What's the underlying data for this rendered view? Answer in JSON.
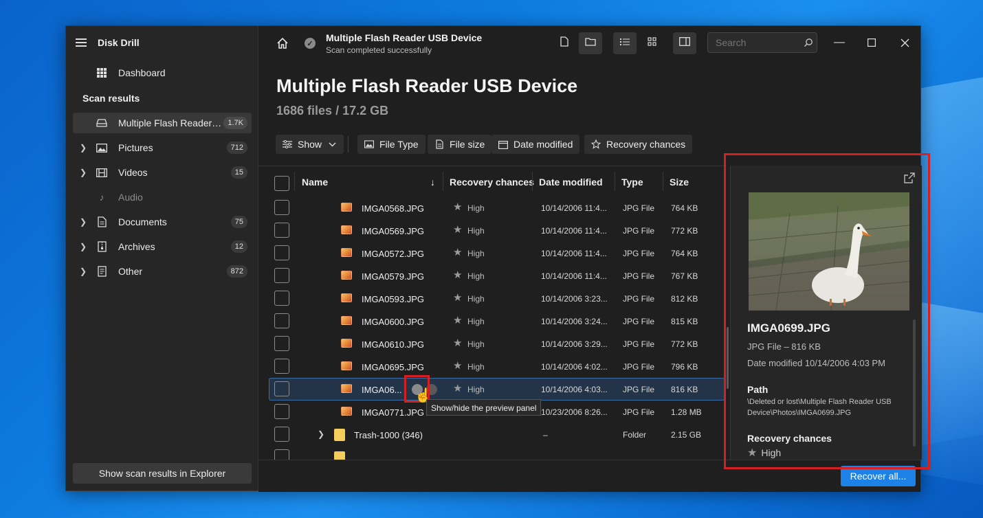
{
  "colors": {
    "accent": "#1d82e8",
    "highlight_box": "#d42020"
  },
  "app": {
    "title": "Disk Drill"
  },
  "sidebar": {
    "dashboard": "Dashboard",
    "section": "Scan results",
    "device": {
      "label": "Multiple Flash Reader U...",
      "count": "1.7K"
    },
    "items": [
      {
        "label": "Pictures",
        "count": "712",
        "icon": "picture-icon"
      },
      {
        "label": "Videos",
        "count": "15",
        "icon": "film-icon"
      },
      {
        "label": "Audio",
        "count": "",
        "icon": "music-icon"
      },
      {
        "label": "Documents",
        "count": "75",
        "icon": "document-icon"
      },
      {
        "label": "Archives",
        "count": "12",
        "icon": "archive-icon"
      },
      {
        "label": "Other",
        "count": "872",
        "icon": "other-file-icon"
      }
    ],
    "explorer_button": "Show scan results in Explorer"
  },
  "topbar": {
    "title": "Multiple Flash Reader USB Device",
    "subtitle": "Scan completed successfully",
    "search_placeholder": "Search"
  },
  "page": {
    "title": "Multiple Flash Reader USB Device",
    "subtitle": "1686 files / 17.2 GB"
  },
  "filters": {
    "show": "Show",
    "file_type": "File Type",
    "file_size": "File size",
    "date_modified": "Date modified",
    "recovery_chances": "Recovery chances"
  },
  "table": {
    "headers": {
      "name": "Name",
      "recovery": "Recovery chances",
      "date": "Date modified",
      "type": "Type",
      "size": "Size"
    },
    "rows": [
      {
        "name": "IMGA0568.JPG",
        "chance": "High",
        "date": "10/14/2006 11:4...",
        "type": "JPG File",
        "size": "764 KB"
      },
      {
        "name": "IMGA0569.JPG",
        "chance": "High",
        "date": "10/14/2006 11:4...",
        "type": "JPG File",
        "size": "772 KB"
      },
      {
        "name": "IMGA0572.JPG",
        "chance": "High",
        "date": "10/14/2006 11:4...",
        "type": "JPG File",
        "size": "764 KB"
      },
      {
        "name": "IMGA0579.JPG",
        "chance": "High",
        "date": "10/14/2006 11:4...",
        "type": "JPG File",
        "size": "767 KB"
      },
      {
        "name": "IMGA0593.JPG",
        "chance": "High",
        "date": "10/14/2006 3:23...",
        "type": "JPG File",
        "size": "812 KB"
      },
      {
        "name": "IMGA0600.JPG",
        "chance": "High",
        "date": "10/14/2006 3:24...",
        "type": "JPG File",
        "size": "815 KB"
      },
      {
        "name": "IMGA0610.JPG",
        "chance": "High",
        "date": "10/14/2006 3:29...",
        "type": "JPG File",
        "size": "772 KB"
      },
      {
        "name": "IMGA0695.JPG",
        "chance": "High",
        "date": "10/14/2006 4:02...",
        "type": "JPG File",
        "size": "796 KB"
      },
      {
        "name": "IMGA06...",
        "chance": "High",
        "date": "10/14/2006 4:03...",
        "type": "JPG File",
        "size": "816 KB"
      },
      {
        "name": "IMGA0771.JPG",
        "chance": "",
        "date": "10/23/2006 8:26...",
        "type": "JPG File",
        "size": "1.28 MB"
      }
    ],
    "folder": {
      "name": "Trash-1000 (346)",
      "date": "–",
      "type": "Folder",
      "size": "2.15 GB"
    }
  },
  "tooltip": "Show/hide the preview panel",
  "preview": {
    "filename": "IMGA0699.JPG",
    "type_size": "JPG File – 816 KB",
    "date_modified": "Date modified 10/14/2006 4:03 PM",
    "path_label": "Path",
    "path": "\\Deleted or lost\\Multiple Flash Reader USB Device\\Photos\\IMGA0699.JPG",
    "recovery_label": "Recovery chances",
    "recovery_value": "High"
  },
  "actions": {
    "recover_all": "Recover all..."
  }
}
